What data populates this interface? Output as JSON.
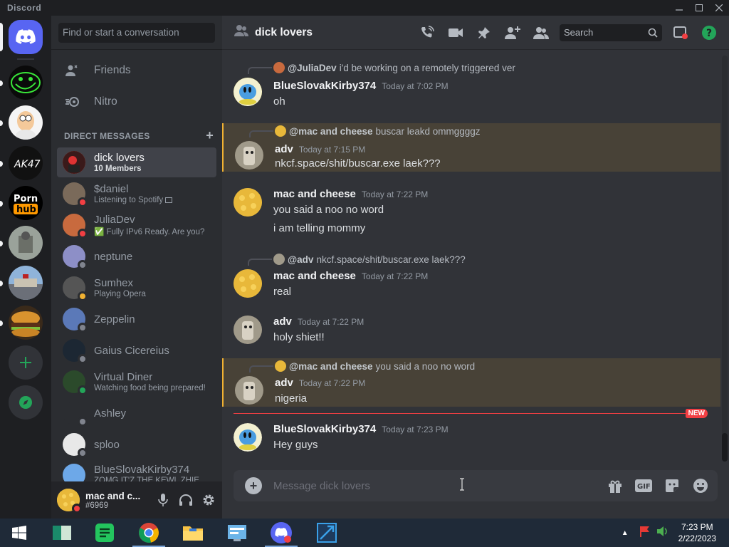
{
  "app": {
    "name": "Discord"
  },
  "colors": {
    "blurple": "#5865f2",
    "green": "#23a559",
    "red": "#f23f43",
    "highlight": "#f0b132"
  },
  "sidebar": {
    "search_placeholder": "Find or start a conversation",
    "nav": [
      {
        "label": "Friends",
        "icon": "friends-icon"
      },
      {
        "label": "Nitro",
        "icon": "nitro-icon"
      }
    ],
    "dm_header": "DIRECT MESSAGES",
    "dms": [
      {
        "name": "dick lovers",
        "sub": "10 Members",
        "status": "none",
        "active": true
      },
      {
        "name": "$daniel",
        "sub": "Listening to Spotify",
        "status": "dnd"
      },
      {
        "name": "JuliaDev",
        "sub": "✅ Fully IPv6 Ready. Are you?",
        "status": "dnd"
      },
      {
        "name": "neptune",
        "sub": "",
        "status": "offline"
      },
      {
        "name": "Sumhex",
        "sub": "Playing Opera",
        "status": "idle"
      },
      {
        "name": "Zeppelin",
        "sub": "",
        "status": "offline"
      },
      {
        "name": "Gaius Cicereius",
        "sub": "",
        "status": "offline"
      },
      {
        "name": "Virtual Diner",
        "sub": "Watching food being prepared!",
        "status": "online"
      },
      {
        "name": "Ashley",
        "sub": "",
        "status": "offline"
      },
      {
        "name": "sploo",
        "sub": "",
        "status": "offline"
      },
      {
        "name": "BlueSlovakKirby374",
        "sub": "ZOMG IT'Z THE KEWL ZHIE",
        "status": "offline"
      }
    ]
  },
  "user": {
    "name": "mac and c...",
    "tag": "#6969"
  },
  "chat": {
    "title": "dick lovers",
    "search_placeholder": "Search",
    "composer_placeholder": "Message dick lovers",
    "new_badge": "NEW",
    "messages": [
      {
        "reply_to": "@JuliaDev",
        "reply_text": "i'd be working on a remotely triggered ver",
        "author": "BlueSlovakKirby374",
        "time": "Today at 7:02 PM",
        "lines": [
          "oh"
        ]
      },
      {
        "reply_to": "@mac and cheese",
        "reply_text": "buscar leakd ommggggz",
        "author": "adv",
        "time": "Today at 7:15 PM",
        "lines": [
          "nkcf.space/shit/buscar.exe laek???"
        ],
        "highlight": true
      },
      {
        "author": "mac and cheese",
        "time": "Today at 7:22 PM",
        "lines": [
          "you said a noo no word",
          "i am telling mommy"
        ]
      },
      {
        "reply_to": "@adv",
        "reply_text": "nkcf.space/shit/buscar.exe laek???",
        "author": "mac and cheese",
        "time": "Today at 7:22 PM",
        "lines": [
          "real"
        ]
      },
      {
        "author": "adv",
        "time": "Today at 7:22 PM",
        "lines": [
          "holy shiet!!"
        ]
      },
      {
        "reply_to": "@mac and cheese",
        "reply_text": "you said a noo no word",
        "author": "adv",
        "time": "Today at 7:22 PM",
        "lines": [
          "nigeria"
        ],
        "highlight": true
      },
      {
        "author": "BlueSlovakKirby374",
        "time": "Today at 7:23 PM",
        "lines": [
          "Hey guys"
        ]
      }
    ]
  },
  "taskbar": {
    "clock_time": "7:23 PM",
    "clock_date": "2/22/2023"
  }
}
